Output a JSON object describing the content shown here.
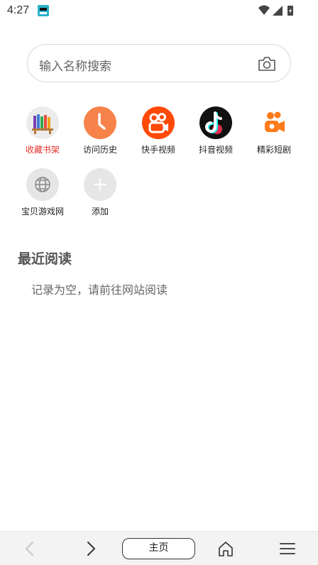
{
  "status_bar": {
    "time": "4:27"
  },
  "search": {
    "placeholder": "输入名称搜索"
  },
  "shortcuts": [
    {
      "label": "收藏书架"
    },
    {
      "label": "访问历史"
    },
    {
      "label": "快手视频"
    },
    {
      "label": "抖音视频"
    },
    {
      "label": "精彩短剧"
    },
    {
      "label": "宝贝游戏网"
    },
    {
      "label": "添加"
    }
  ],
  "recent": {
    "title": "最近阅读",
    "empty_message": "记录为空，请前往网站阅读"
  },
  "bottom_bar": {
    "home_label": "主页"
  },
  "colors": {
    "history": "#f7834a",
    "kuaishou": "#ff4906",
    "douyin": "#111111",
    "duanju": "#ff7a1a",
    "bookshelf_active": "#e5322d"
  }
}
